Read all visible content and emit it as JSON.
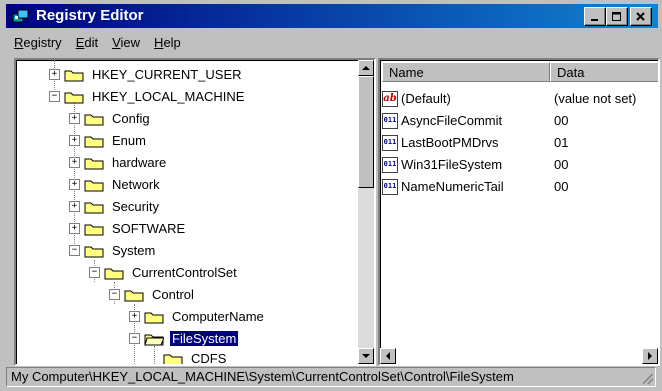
{
  "window": {
    "title": "Registry Editor"
  },
  "menu": [
    {
      "label": "Registry",
      "accel": "R",
      "rest": "egistry"
    },
    {
      "label": "Edit",
      "accel": "E",
      "rest": "dit"
    },
    {
      "label": "View",
      "accel": "V",
      "rest": "iew"
    },
    {
      "label": "Help",
      "accel": "H",
      "rest": "elp"
    }
  ],
  "tree": [
    {
      "label": "HKEY_CURRENT_USER",
      "expander": "+"
    },
    {
      "label": "HKEY_LOCAL_MACHINE",
      "expander": "−"
    },
    {
      "label": "Config",
      "expander": "+"
    },
    {
      "label": "Enum",
      "expander": "+"
    },
    {
      "label": "hardware",
      "expander": "+"
    },
    {
      "label": "Network",
      "expander": "+"
    },
    {
      "label": "Security",
      "expander": "+"
    },
    {
      "label": "SOFTWARE",
      "expander": "+"
    },
    {
      "label": "System",
      "expander": "−"
    },
    {
      "label": "CurrentControlSet",
      "expander": "−"
    },
    {
      "label": "Control",
      "expander": "−"
    },
    {
      "label": "ComputerName",
      "expander": "+"
    },
    {
      "label": "FileSystem",
      "expander": "−",
      "selected": true
    },
    {
      "label": "CDFS",
      "expander": ""
    }
  ],
  "values_header": {
    "name": "Name",
    "data": "Data"
  },
  "values": [
    {
      "type": "string",
      "icon": "ab",
      "name": "(Default)",
      "data": "(value not set)"
    },
    {
      "type": "binary",
      "icon": "011",
      "name": "AsyncFileCommit",
      "data": "00"
    },
    {
      "type": "binary",
      "icon": "011",
      "name": "LastBootPMDrvs",
      "data": "01"
    },
    {
      "type": "binary",
      "icon": "011",
      "name": "Win31FileSystem",
      "data": "00"
    },
    {
      "type": "binary",
      "icon": "011",
      "name": "NameNumericTail",
      "data": "00"
    }
  ],
  "status": {
    "path": "My Computer\\HKEY_LOCAL_MACHINE\\System\\CurrentControlSet\\Control\\FileSystem"
  },
  "colors": {
    "titlebar": "#000080",
    "selection": "#000080",
    "tree_bg": "#ffffff",
    "chrome": "#c0c0c0"
  }
}
